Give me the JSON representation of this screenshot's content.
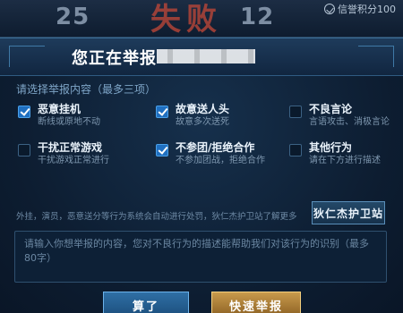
{
  "top": {
    "score_left": "25",
    "result_text": "失败",
    "score_right": "12",
    "credit_text": "信誉积分100"
  },
  "dialog": {
    "title": "您正在举报",
    "subtitle": "请选择举报内容（最多三项）",
    "options": [
      {
        "label": "恶意挂机",
        "desc": "断线或原地不动",
        "checked": true
      },
      {
        "label": "故意送人头",
        "desc": "故意多次送死",
        "checked": true
      },
      {
        "label": "不良言论",
        "desc": "言语攻击、消极言论",
        "checked": false
      },
      {
        "label": "干扰正常游戏",
        "desc": "干扰游戏正常进行",
        "checked": false
      },
      {
        "label": "不参团/拒绝合作",
        "desc": "不参加团战，拒绝合作",
        "checked": true
      },
      {
        "label": "其他行为",
        "desc": "请在下方进行描述",
        "checked": false
      }
    ],
    "notice": "外挂，演员，恶意送分等行为系统会自动进行处罚，狄仁杰护卫站了解更多",
    "guard_button": "狄仁杰护卫站",
    "textarea_placeholder": "请输入你想举报的内容，您对不良行为的描述能帮助我们对该行为的识别（最多80字）",
    "cancel_button": "算了",
    "report_button": "快速举报"
  },
  "colors": {
    "accent_blue": "#1f6fc0",
    "report_gold": "#c89a4c",
    "defeat_red": "#c44838"
  }
}
